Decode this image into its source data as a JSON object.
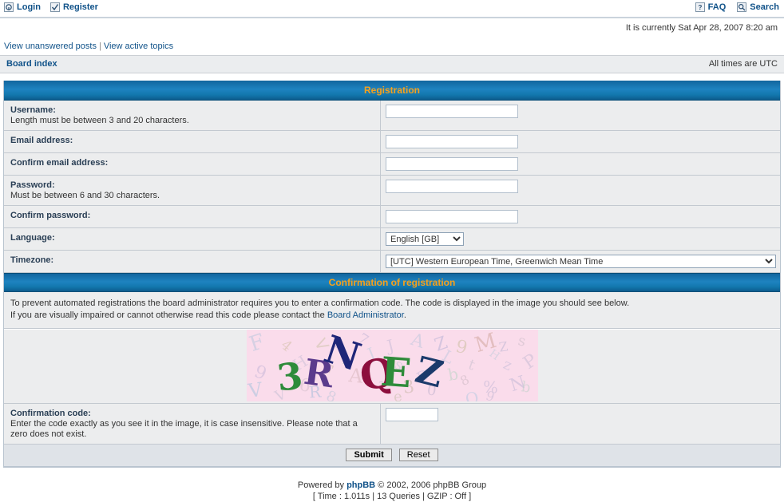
{
  "topnav": {
    "left": [
      {
        "label": "Login",
        "icon": "login-icon"
      },
      {
        "label": "Register",
        "icon": "register-icon"
      }
    ],
    "right": [
      {
        "label": "FAQ",
        "icon": "faq-icon"
      },
      {
        "label": "Search",
        "icon": "search-icon"
      }
    ]
  },
  "currently": "It is currently Sat Apr 28, 2007 8:20 am",
  "linkbar": {
    "unanswered": "View unanswered posts",
    "separator": "|",
    "active": "View active topics"
  },
  "navstrip": {
    "breadcrumb": "Board index",
    "times": "All times are UTC"
  },
  "registration": {
    "title": "Registration",
    "rows": [
      {
        "label": "Username:",
        "hint": "Length must be between 3 and 20 characters.",
        "field": "text",
        "value": "",
        "name": "username-field"
      },
      {
        "label": "Email address:",
        "hint": "",
        "field": "text",
        "value": "",
        "name": "email-field"
      },
      {
        "label": "Confirm email address:",
        "hint": "",
        "field": "text",
        "value": "",
        "name": "confirm-email-field"
      },
      {
        "label": "Password:",
        "hint": "Must be between 6 and 30 characters.",
        "field": "password",
        "value": "",
        "name": "password-field"
      },
      {
        "label": "Confirm password:",
        "hint": "",
        "field": "password",
        "value": "",
        "name": "confirm-password-field"
      }
    ],
    "language": {
      "label": "Language:",
      "selected": "English [GB]",
      "options": [
        "English [GB]"
      ]
    },
    "timezone": {
      "label": "Timezone:",
      "selected": "[UTC] Western European Time, Greenwich Mean Time",
      "options": [
        "[UTC] Western European Time, Greenwich Mean Time"
      ]
    }
  },
  "confirmation": {
    "title": "Confirmation of registration",
    "explain_line1": "To prevent automated registrations the board administrator requires you to enter a confirmation code. The code is displayed in the image you should see below.",
    "explain_line2_pre": "If you are visually impaired or cannot otherwise read this code please contact the ",
    "explain_link": "Board Administrator",
    "explain_line2_post": ".",
    "captcha": {
      "code": "3RNQEZ",
      "background": "#fadceb",
      "characters": [
        {
          "char": "3",
          "color": "#2e8b3a"
        },
        {
          "char": "R",
          "color": "#5b3b8c"
        },
        {
          "char": "N",
          "color": "#1e2678"
        },
        {
          "char": "Q",
          "color": "#8c0f3d"
        },
        {
          "char": "E",
          "color": "#2e8b3a"
        },
        {
          "char": "Z",
          "color": "#1b3a6b"
        }
      ]
    },
    "code_label": "Confirmation code:",
    "code_hint": "Enter the code exactly as you see it in the image, it is case insensitive. Please note that a zero does not exist.",
    "code_value": ""
  },
  "buttons": {
    "submit": "Submit",
    "reset": "Reset"
  },
  "footer": {
    "powered_pre": "Powered by ",
    "powered_link": "phpBB",
    "powered_post": " © 2002, 2006 phpBB Group",
    "stats": "[ Time : 1.011s | 13 Queries | GZIP : Off ]"
  }
}
